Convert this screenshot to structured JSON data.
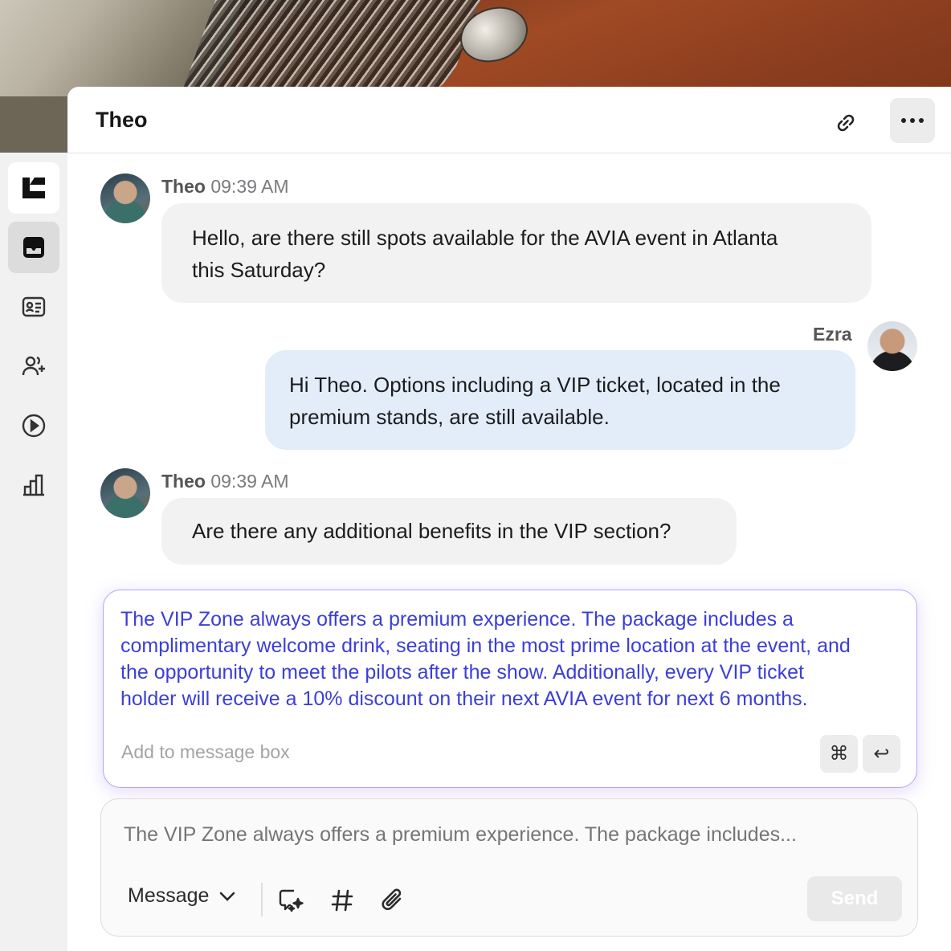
{
  "header": {
    "title": "Theo"
  },
  "messages": [
    {
      "sender": "Theo",
      "time": "09:39 AM",
      "text_line1": "Hello, are there still spots available for the AVIA event in Atlanta",
      "text_line2": "this Saturday?"
    },
    {
      "sender": "Ezra",
      "text_line1": "Hi Theo. Options including a VIP ticket, located in the",
      "text_line2": "premium stands, are still available."
    },
    {
      "sender": "Theo",
      "time": "09:39 AM",
      "text_line1": "Are there any additional benefits in the VIP section?"
    }
  ],
  "suggestion": {
    "lines": [
      "The VIP Zone always offers a premium experience. The package includes a",
      "complimentary welcome drink, seating in the most prime location at the event, and",
      "the opportunity to meet the pilots after the show. Additionally, every VIP ticket",
      "holder will receive a 10% discount on their next AVIA event for next 6 months."
    ],
    "hint": "Add to message box",
    "shortcut_key": "⌘",
    "enter_key": "↩"
  },
  "composer": {
    "placeholder": "The VIP Zone always offers a premium experience. The package includes...",
    "mode_label": "Message",
    "send_label": "Send"
  },
  "sidebar": {
    "items": [
      "logo-icon",
      "inbox-icon",
      "contact-card-icon",
      "add-user-icon",
      "play-icon",
      "bar-chart-icon"
    ]
  },
  "colors": {
    "suggestion_text": "#3b3fd8",
    "outgoing_bubble": "#e3edf9",
    "incoming_bubble": "#f2f2f2"
  }
}
